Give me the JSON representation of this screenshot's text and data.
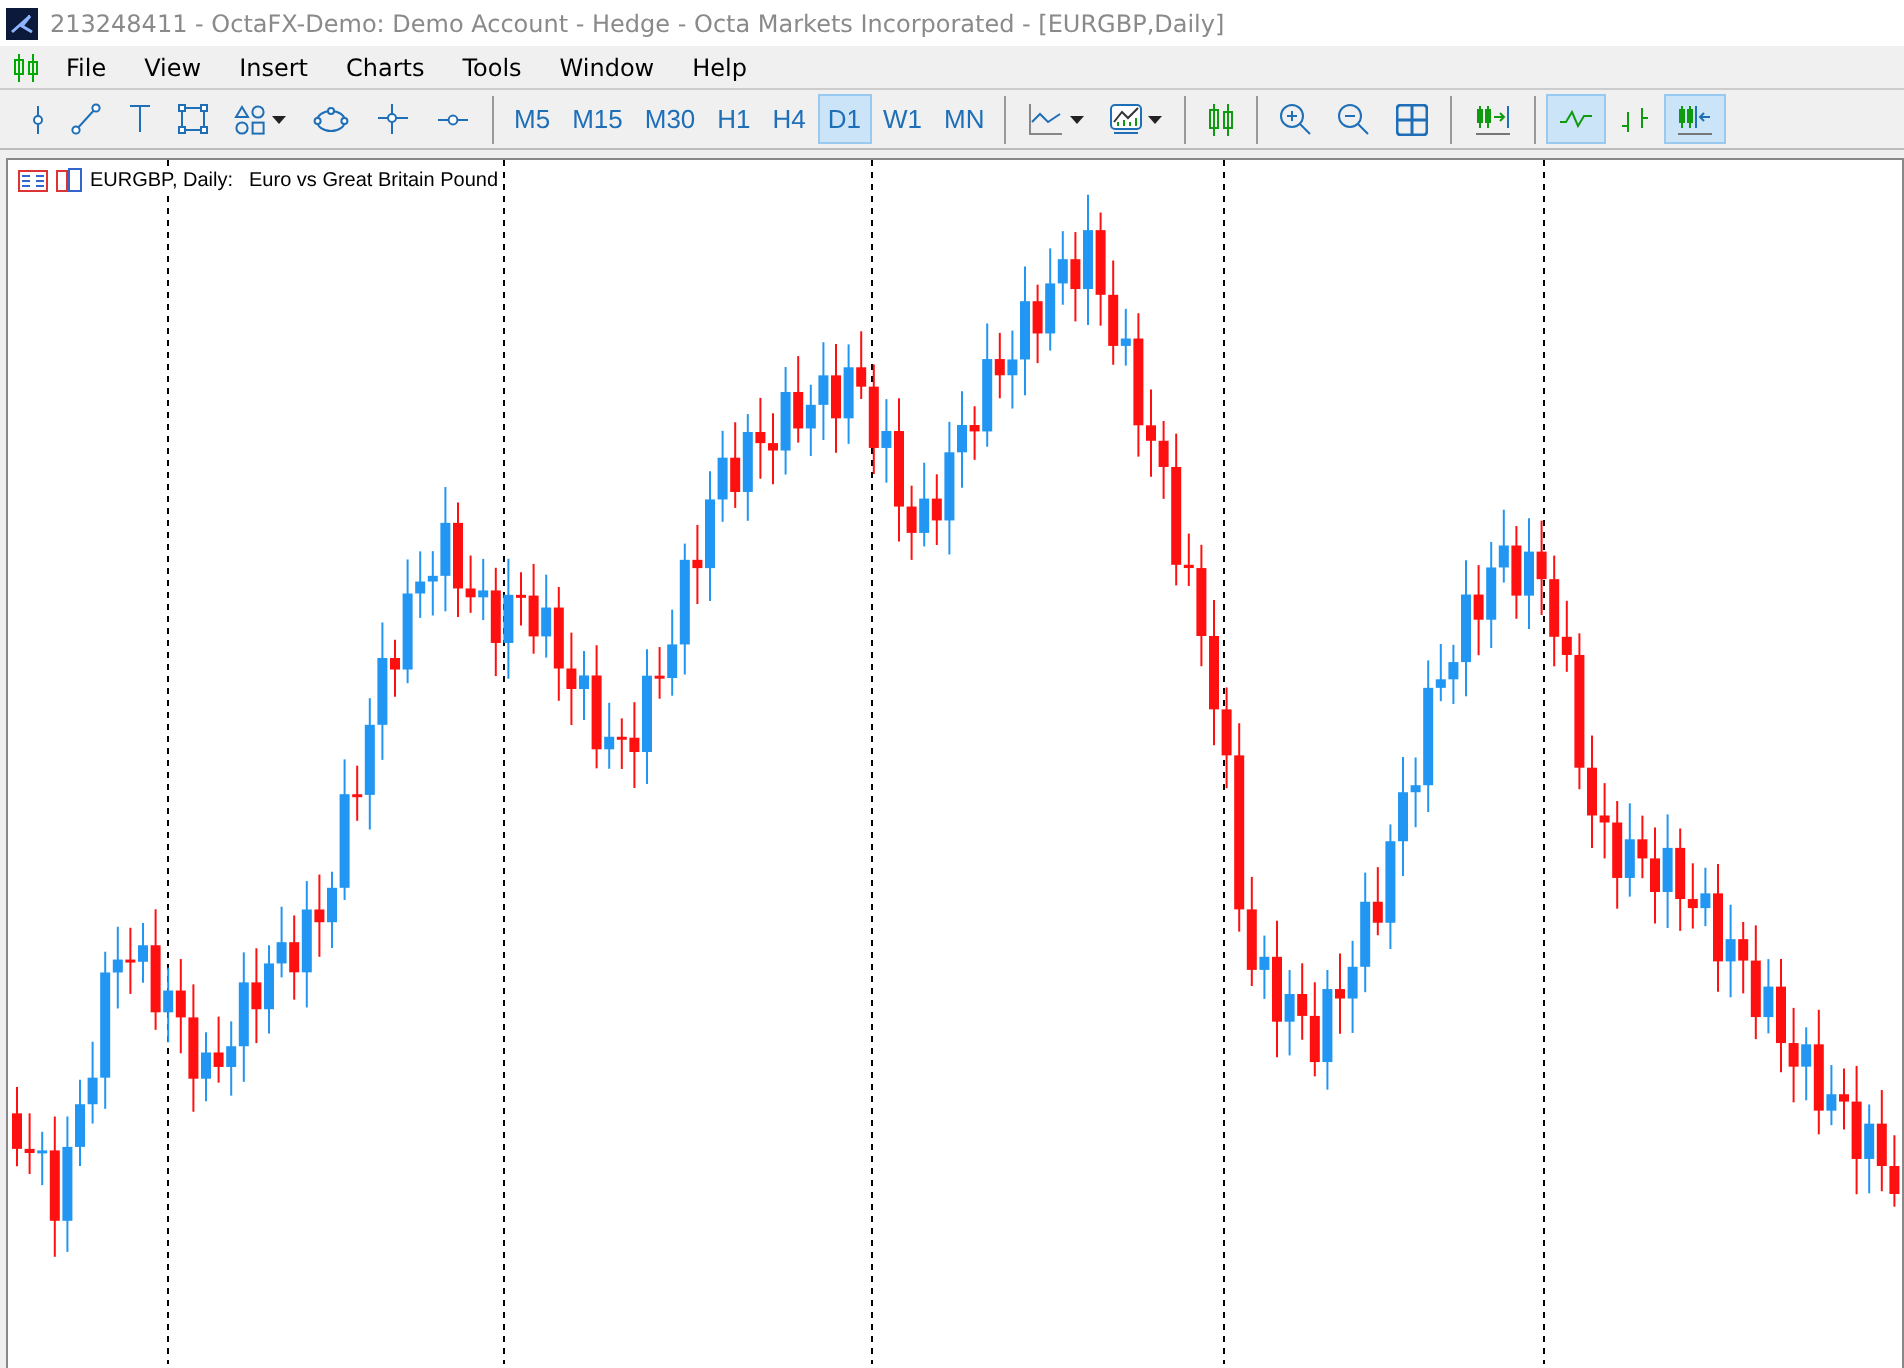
{
  "window": {
    "title": "213248411 - OctaFX-Demo: Demo Account - Hedge - Octa Markets Incorporated - [EURGBP,Daily]"
  },
  "menu": [
    "File",
    "View",
    "Insert",
    "Charts",
    "Tools",
    "Window",
    "Help"
  ],
  "drawing_tools": [
    {
      "kind": "vline",
      "dropdown": false
    },
    {
      "kind": "trendline",
      "dropdown": false
    },
    {
      "kind": "text",
      "dropdown": false
    },
    {
      "kind": "rectangle",
      "dropdown": false
    },
    {
      "kind": "shapes",
      "dropdown": true
    },
    {
      "kind": "ellipse",
      "dropdown": false
    },
    {
      "kind": "crosshair",
      "dropdown": false
    },
    {
      "kind": "hline",
      "dropdown": false
    }
  ],
  "timeframes": [
    {
      "label": "M5",
      "selected": false
    },
    {
      "label": "M15",
      "selected": false
    },
    {
      "label": "M30",
      "selected": false
    },
    {
      "label": "H1",
      "selected": false
    },
    {
      "label": "H4",
      "selected": false
    },
    {
      "label": "D1",
      "selected": true
    },
    {
      "label": "W1",
      "selected": false
    },
    {
      "label": "MN",
      "selected": false
    }
  ],
  "chart_tool_groups": [
    [
      {
        "kind": "indicators",
        "dropdown": true,
        "selected": false
      },
      {
        "kind": "templates",
        "dropdown": true,
        "selected": false
      }
    ],
    [
      {
        "kind": "candles",
        "dropdown": false,
        "selected": false
      }
    ],
    [
      {
        "kind": "zoom-in",
        "dropdown": false,
        "selected": false
      },
      {
        "kind": "zoom-out",
        "dropdown": false,
        "selected": false
      },
      {
        "kind": "tile",
        "dropdown": false,
        "selected": false
      }
    ],
    [
      {
        "kind": "shift-end",
        "dropdown": false,
        "selected": false
      }
    ],
    [
      {
        "kind": "line-chart",
        "dropdown": false,
        "selected": true
      },
      {
        "kind": "bar-chart",
        "dropdown": false,
        "selected": false
      },
      {
        "kind": "autoscroll",
        "dropdown": false,
        "selected": true
      }
    ]
  ],
  "chart": {
    "symbol": "EURGBP, Daily:",
    "description": "Euro vs Great Britain Pound"
  }
}
